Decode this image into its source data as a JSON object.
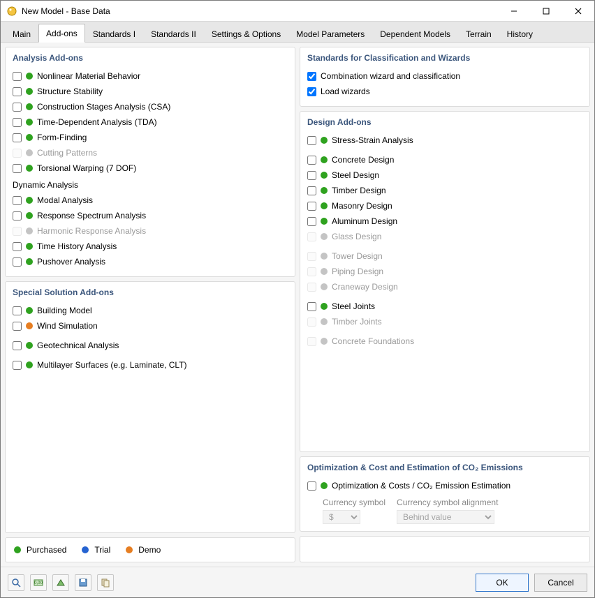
{
  "window": {
    "title": "New Model - Base Data"
  },
  "tabs": [
    "Main",
    "Add-ons",
    "Standards I",
    "Standards II",
    "Settings & Options",
    "Model Parameters",
    "Dependent Models",
    "Terrain",
    "History"
  ],
  "active_tab_index": 1,
  "left": {
    "analysis": {
      "title": "Analysis Add-ons",
      "items": [
        {
          "label": "Nonlinear Material Behavior",
          "dot": "green",
          "checked": false,
          "disabled": false
        },
        {
          "label": "Structure Stability",
          "dot": "green",
          "checked": false,
          "disabled": false
        },
        {
          "label": "Construction Stages Analysis (CSA)",
          "dot": "green",
          "checked": false,
          "disabled": false
        },
        {
          "label": "Time-Dependent Analysis (TDA)",
          "dot": "green",
          "checked": false,
          "disabled": false
        },
        {
          "label": "Form-Finding",
          "dot": "green",
          "checked": false,
          "disabled": false
        },
        {
          "label": "Cutting Patterns",
          "dot": "grey",
          "checked": false,
          "disabled": true
        },
        {
          "label": "Torsional Warping (7 DOF)",
          "dot": "green",
          "checked": false,
          "disabled": false
        }
      ],
      "dynamic_title": "Dynamic Analysis",
      "dynamic_items": [
        {
          "label": "Modal Analysis",
          "dot": "green",
          "checked": false,
          "disabled": false
        },
        {
          "label": "Response Spectrum Analysis",
          "dot": "green",
          "checked": false,
          "disabled": false
        },
        {
          "label": "Harmonic Response Analysis",
          "dot": "grey",
          "checked": false,
          "disabled": true
        },
        {
          "label": "Time History Analysis",
          "dot": "green",
          "checked": false,
          "disabled": false
        },
        {
          "label": "Pushover Analysis",
          "dot": "green",
          "checked": false,
          "disabled": false
        }
      ]
    },
    "special": {
      "title": "Special Solution Add-ons",
      "items": [
        {
          "label": "Building Model",
          "dot": "green",
          "checked": false,
          "disabled": false
        },
        {
          "label": "Wind Simulation",
          "dot": "orange",
          "checked": false,
          "disabled": false
        },
        {
          "label": "Geotechnical Analysis",
          "dot": "green",
          "checked": false,
          "disabled": false
        },
        {
          "label": "Multilayer Surfaces (e.g. Laminate, CLT)",
          "dot": "green",
          "checked": false,
          "disabled": false
        }
      ]
    }
  },
  "right": {
    "standards": {
      "title": "Standards for Classification and Wizards",
      "items": [
        {
          "label": "Combination wizard and classification",
          "checked": true
        },
        {
          "label": "Load wizards",
          "checked": true
        }
      ]
    },
    "design": {
      "title": "Design Add-ons",
      "items": [
        {
          "label": "Stress-Strain Analysis",
          "dot": "green",
          "checked": false,
          "disabled": false
        },
        {
          "label": "Concrete Design",
          "dot": "green",
          "checked": false,
          "disabled": false
        },
        {
          "label": "Steel Design",
          "dot": "green",
          "checked": false,
          "disabled": false
        },
        {
          "label": "Timber Design",
          "dot": "green",
          "checked": false,
          "disabled": false
        },
        {
          "label": "Masonry Design",
          "dot": "green",
          "checked": false,
          "disabled": false
        },
        {
          "label": "Aluminum Design",
          "dot": "green",
          "checked": false,
          "disabled": false
        },
        {
          "label": "Glass Design",
          "dot": "grey",
          "checked": false,
          "disabled": true
        },
        {
          "label": "Tower Design",
          "dot": "grey",
          "checked": false,
          "disabled": true
        },
        {
          "label": "Piping Design",
          "dot": "grey",
          "checked": false,
          "disabled": true
        },
        {
          "label": "Craneway Design",
          "dot": "grey",
          "checked": false,
          "disabled": true
        },
        {
          "label": "Steel Joints",
          "dot": "green",
          "checked": false,
          "disabled": false
        },
        {
          "label": "Timber Joints",
          "dot": "grey",
          "checked": false,
          "disabled": true
        },
        {
          "label": "Concrete Foundations",
          "dot": "grey",
          "checked": false,
          "disabled": true
        }
      ]
    },
    "optimization": {
      "title": "Optimization & Cost and Estimation of CO₂ Emissions",
      "item": {
        "label": "Optimization & Costs / CO₂ Emission Estimation",
        "dot": "green",
        "checked": false,
        "disabled": false
      },
      "currency_symbol_label": "Currency symbol",
      "currency_symbol_value": "$",
      "currency_align_label": "Currency symbol alignment",
      "currency_align_value": "Behind value"
    }
  },
  "legend": {
    "purchased": "Purchased",
    "trial": "Trial",
    "demo": "Demo"
  },
  "buttons": {
    "ok": "OK",
    "cancel": "Cancel"
  }
}
